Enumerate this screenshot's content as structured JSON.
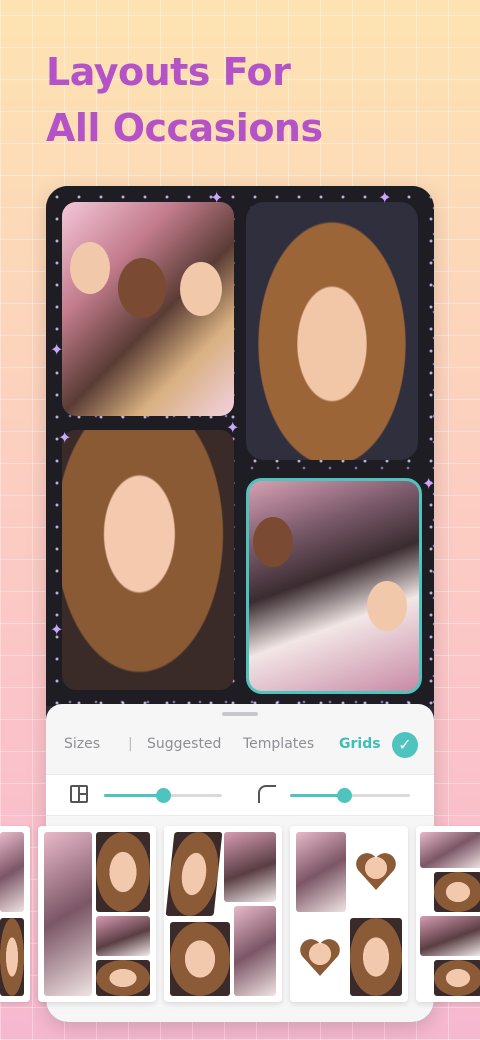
{
  "headline": {
    "line1": "Layouts For",
    "line2": "All Occasions"
  },
  "colors": {
    "headline": "#b452c8",
    "accent": "#4fc3bd",
    "panel": "#f6f6f7"
  },
  "editor": {
    "tabs": [
      {
        "label": "Sizes",
        "active": false
      },
      {
        "label": "Suggested",
        "active": false
      },
      {
        "label": "Templates",
        "active": false
      },
      {
        "label": "Grids",
        "active": true
      }
    ],
    "separator": "|",
    "confirm_icon": "checkmark-icon",
    "sliders": [
      {
        "icon": "layout-border-icon",
        "value": 0.5
      },
      {
        "icon": "corner-radius-icon",
        "value": 0.45
      }
    ]
  },
  "grid_thumbnails": [
    {
      "name": "grid-option-1"
    },
    {
      "name": "grid-option-2"
    },
    {
      "name": "grid-option-3"
    },
    {
      "name": "grid-option-4"
    },
    {
      "name": "grid-option-5"
    }
  ]
}
